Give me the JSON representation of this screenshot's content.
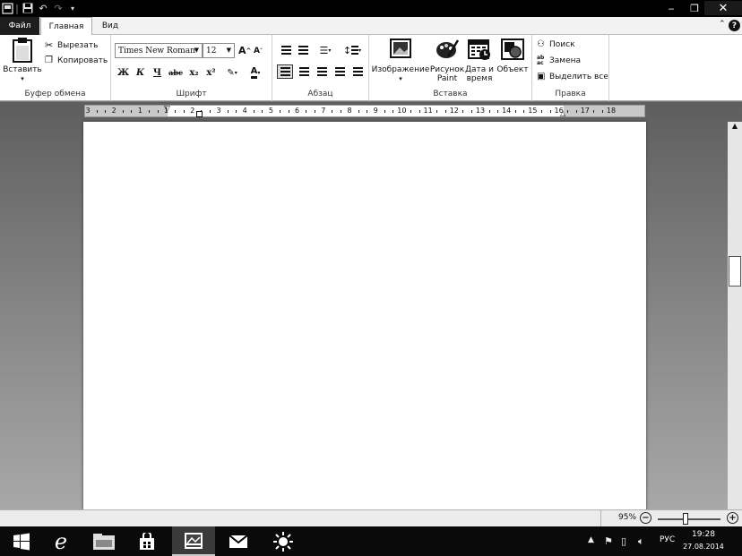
{
  "window": {
    "minimize_glyph": "‒",
    "restore_glyph": "❐",
    "close_glyph": "✕"
  },
  "tabs": {
    "file": "Файл",
    "home": "Главная",
    "view": "Вид"
  },
  "ribbon": {
    "clipboard": {
      "label": "Буфер обмена",
      "paste": "Вставить",
      "cut": "Вырезать",
      "copy": "Копировать"
    },
    "font": {
      "label": "Шрифт",
      "font_name": "Times New Roman",
      "font_size": "12",
      "bold": "Ж",
      "italic": "К",
      "underline": "Ч",
      "strikethrough": "abc",
      "subscript": "x₂",
      "superscript": "x²"
    },
    "paragraph": {
      "label": "Абзац"
    },
    "insert": {
      "label": "Вставка",
      "image": "Изображение",
      "paint_drawing": "Рисунок Paint",
      "date_time": "Дата и время",
      "object": "Объект"
    },
    "editing": {
      "label": "Правка",
      "find": "Поиск",
      "replace": "Замена",
      "select_all": "Выделить все"
    }
  },
  "ruler": {
    "labels": [
      "3",
      "2",
      "1",
      "1",
      "2",
      "3",
      "4",
      "5",
      "6",
      "7",
      "8",
      "9",
      "10",
      "11",
      "12",
      "13",
      "14",
      "15",
      "16",
      "17",
      "18"
    ]
  },
  "status": {
    "zoom": "95%",
    "zoom_out": "−",
    "zoom_in": "+"
  },
  "taskbar": {
    "language": "РУС",
    "time": "19:28",
    "date": "27.08.2014"
  }
}
